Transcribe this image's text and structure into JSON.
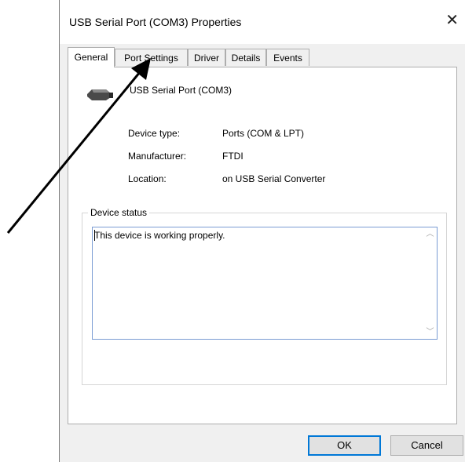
{
  "window": {
    "title": "USB Serial Port (COM3) Properties"
  },
  "tabs": [
    {
      "label": "General",
      "active": true
    },
    {
      "label": "Port Settings",
      "active": false
    },
    {
      "label": "Driver",
      "active": false
    },
    {
      "label": "Details",
      "active": false
    },
    {
      "label": "Events",
      "active": false
    }
  ],
  "general": {
    "device_name": "USB Serial Port (COM3)",
    "device_icon": "serial-port-connector-icon",
    "properties": [
      {
        "label": "Device type:",
        "value": "Ports (COM & LPT)"
      },
      {
        "label": "Manufacturer:",
        "value": "FTDI"
      },
      {
        "label": "Location:",
        "value": "on USB Serial Converter"
      }
    ],
    "status": {
      "legend": "Device status",
      "text": "This device is working properly."
    }
  },
  "buttons": {
    "ok": "OK",
    "cancel": "Cancel"
  },
  "annotation": {
    "type": "arrow",
    "points_to": "Port Settings tab",
    "color": "#000000"
  }
}
